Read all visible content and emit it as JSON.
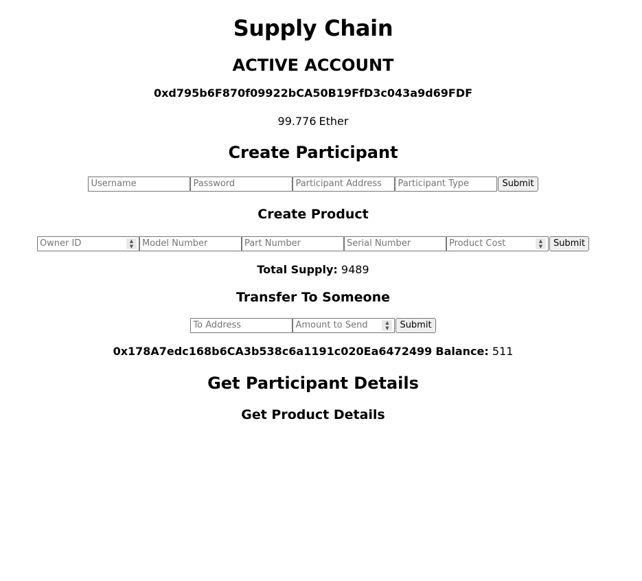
{
  "title": "Supply Chain",
  "active_account": {
    "heading": "ACTIVE ACCOUNT",
    "address": "0xd795b6F870f09922bCA50B19FfD3c043a9d69FDF",
    "balance_value": "99.776",
    "balance_unit": "Ether"
  },
  "create_participant": {
    "heading": "Create Participant",
    "username_placeholder": "Username",
    "password_placeholder": "Password",
    "address_placeholder": "Participant Address",
    "type_placeholder": "Participant Type",
    "submit_label": "Submit"
  },
  "create_product": {
    "heading": "Create Product",
    "owner_id_placeholder": "Owner ID",
    "model_number_placeholder": "Model Number",
    "part_number_placeholder": "Part Number",
    "serial_number_placeholder": "Serial Number",
    "product_cost_placeholder": "Product Cost",
    "submit_label": "Submit"
  },
  "total_supply": {
    "label": "Total Supply:",
    "value": "9489"
  },
  "transfer": {
    "heading": "Transfer To Someone",
    "to_address_placeholder": "To Address",
    "amount_placeholder": "Amount to Send",
    "submit_label": "Submit",
    "recipient_address": "0x178A7edc168b6CA3b538c6a1191c020Ea6472499",
    "balance_label": "Balance:",
    "balance_value": "511"
  },
  "participant_details": {
    "heading": "Get Participant Details"
  },
  "product_details": {
    "heading": "Get Product Details"
  }
}
